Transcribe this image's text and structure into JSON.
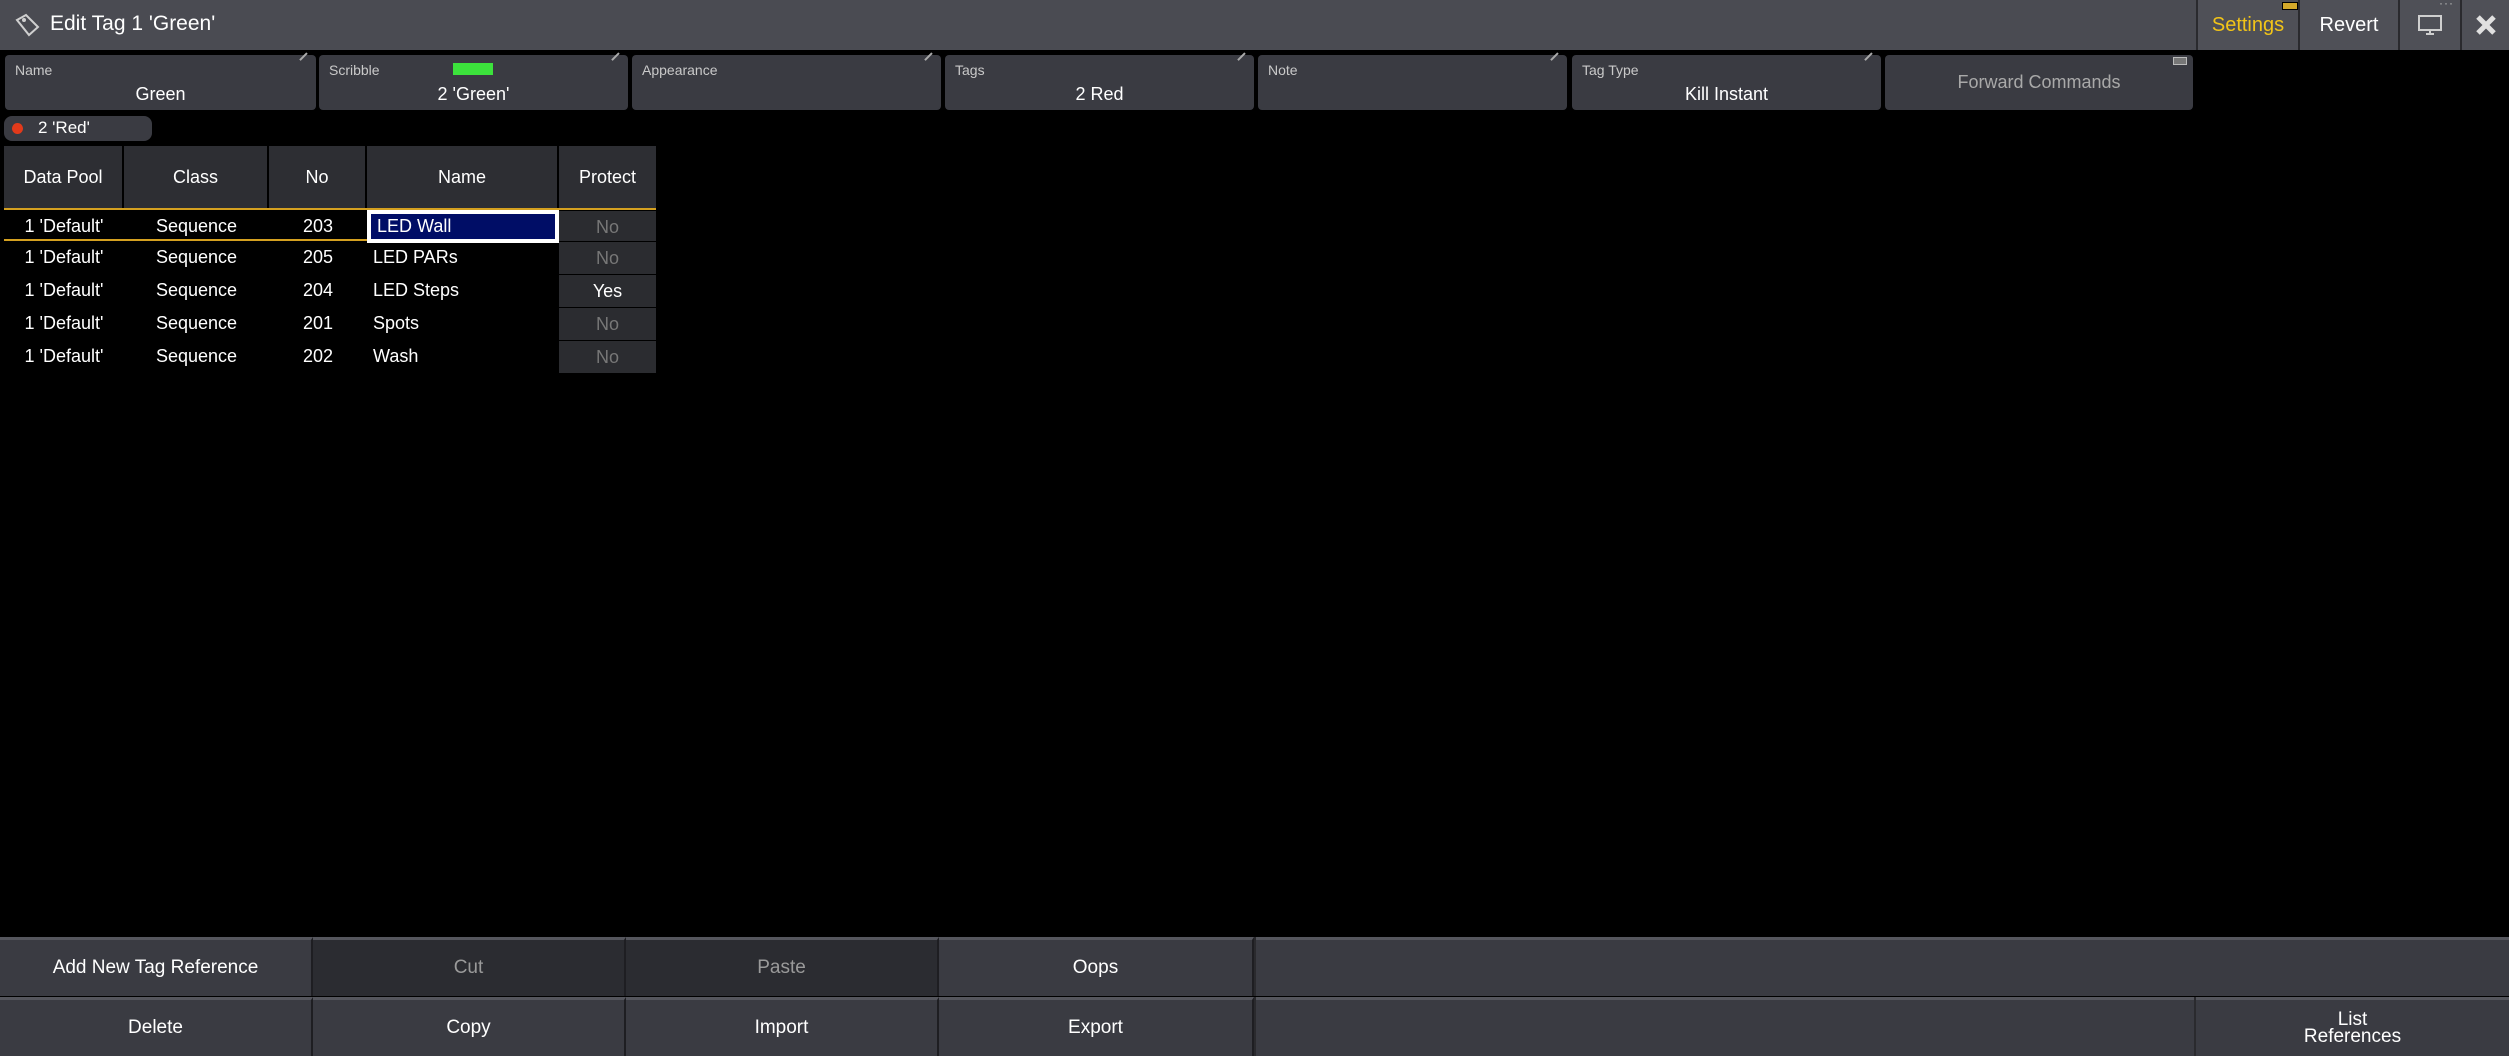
{
  "title": "Edit Tag 1 'Green'",
  "titlebar": {
    "settings_label": "Settings",
    "revert_label": "Revert",
    "accent": "#f2c418"
  },
  "properties": [
    {
      "label": "Name",
      "value": "Green"
    },
    {
      "label": "Scribble",
      "value": "2 'Green'"
    },
    {
      "label": "Appearance",
      "value": ""
    },
    {
      "label": "Tags",
      "value": "2 Red"
    },
    {
      "label": "Note",
      "value": ""
    },
    {
      "label": "Tag Type",
      "value": "Kill Instant"
    }
  ],
  "scribble_color": "#3ce23c",
  "forward_commands_label": "Forward Commands",
  "filter_chip": {
    "label": "2 'Red'",
    "dot_color": "#e23a1b"
  },
  "table": {
    "columns": [
      "Data Pool",
      "Class",
      "No",
      "Name",
      "Protect"
    ],
    "rows": [
      {
        "pool": "1 'Default'",
        "class": "Sequence",
        "no": "203",
        "name": "LED Wall",
        "protect": "No",
        "selected": true
      },
      {
        "pool": "1 'Default'",
        "class": "Sequence",
        "no": "205",
        "name": "LED PARs",
        "protect": "No"
      },
      {
        "pool": "1 'Default'",
        "class": "Sequence",
        "no": "204",
        "name": "LED Steps",
        "protect": "Yes"
      },
      {
        "pool": "1 'Default'",
        "class": "Sequence",
        "no": "201",
        "name": "Spots",
        "protect": "No"
      },
      {
        "pool": "1 'Default'",
        "class": "Sequence",
        "no": "202",
        "name": "Wash",
        "protect": "No"
      }
    ]
  },
  "bottom": {
    "row1": [
      "Add New Tag Reference",
      "Cut",
      "Paste",
      "Oops"
    ],
    "row2": [
      "Delete",
      "Copy",
      "Import",
      "Export"
    ],
    "list_references_line1": "List",
    "list_references_line2": "References"
  }
}
